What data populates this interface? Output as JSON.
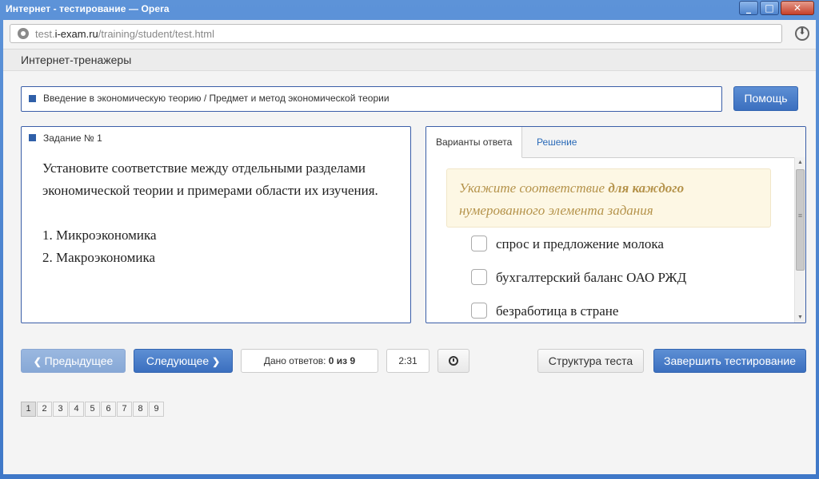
{
  "window": {
    "title": "Интернет - тестирование — Opera"
  },
  "browser": {
    "url_prefix": "test.",
    "url_domain": "i-exam.ru",
    "url_path": "/training/student/test.html"
  },
  "site": {
    "nav_title": "Интернет-тренажеры"
  },
  "breadcrumb": {
    "text": "Введение в экономическую теорию / Предмет и метод экономической теории"
  },
  "help_button": "Помощь",
  "task": {
    "header": "Задание № 1",
    "question": "Установите соответствие между отдельными разделами экономической теории и примерами области их изучения.",
    "items": [
      "1. Микроэкономика",
      "2. Макроэкономика"
    ]
  },
  "answer_panel": {
    "tab_variants": "Варианты ответа",
    "tab_solution": "Решение",
    "hint_part1": "Укажите соответствие ",
    "hint_bold": "для каждого",
    "hint_part2": " нумерованного элемента задания",
    "options": [
      "спрос и предложение молока",
      "бухгалтерский баланс ОАО РЖД",
      "безработица в стране"
    ]
  },
  "controls": {
    "prev_label": "Предыдущее",
    "next_label": "Следующее",
    "answers_label": "Дано ответов:",
    "answers_value": "0 из 9",
    "timer": "2:31",
    "structure_label": "Структура теста",
    "finish_label": "Завершить тестирование"
  },
  "pagination": [
    "1",
    "2",
    "3",
    "4",
    "5",
    "6",
    "7",
    "8",
    "9"
  ],
  "icons": [
    "site-info-icon",
    "download-icon",
    "minimize-icon",
    "maximize-icon",
    "close-icon",
    "chevron-left-icon",
    "chevron-right-icon",
    "clock-icon"
  ],
  "colors": {
    "accent": "#3b6fbf",
    "border": "#3a5ea8",
    "hint_bg": "#fdf7e4",
    "hint_text": "#b5934b"
  }
}
